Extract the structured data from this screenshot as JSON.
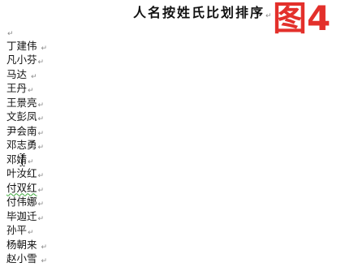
{
  "document": {
    "title": "人名按姓氏比划排序",
    "paragraph_mark": "↵",
    "names": [
      {
        "text": "丁建伟 "
      },
      {
        "text": "凡小芬"
      },
      {
        "text": "马达 "
      },
      {
        "text": "王丹"
      },
      {
        "text": "王景亮"
      },
      {
        "text": "文彭凤"
      },
      {
        "text": "尹会南"
      },
      {
        "text": "邓志勇"
      },
      {
        "text": "邓婧"
      },
      {
        "text": "叶汝红"
      },
      {
        "text": "付双红",
        "grammar_flag": true
      },
      {
        "text": "付伟娜"
      },
      {
        "text": "毕迦迁"
      },
      {
        "text": "孙平"
      },
      {
        "text": "杨朝来 "
      },
      {
        "text": "赵小雪 "
      }
    ]
  },
  "annotation": {
    "label": "图4",
    "color": "#e3302b"
  },
  "colors": {
    "text": "#111111",
    "paragraph_mark": "#8a8a8a",
    "grammar_underline": "#3aa83a"
  }
}
